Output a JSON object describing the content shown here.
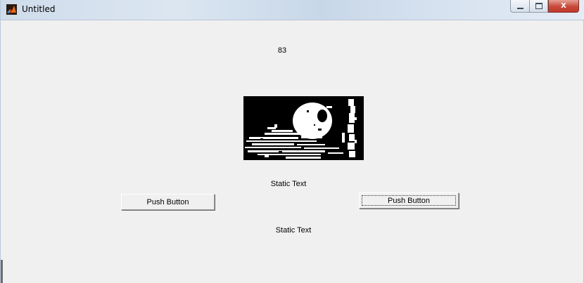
{
  "window": {
    "title": "Untitled",
    "caption_buttons": {
      "minimize_icon": "minimize-icon",
      "maximize_icon": "maximize-icon",
      "close_glyph": "X"
    }
  },
  "figure": {
    "value_display": "83",
    "image_description_icon": "binary-image",
    "static_text_top": "Static Text",
    "static_text_bottom": "Static Text",
    "push_button_left": "Push Button",
    "push_button_right": "Push Button"
  },
  "colors": {
    "window_background": "#f0f0f0",
    "close_button": "#c8493a",
    "axes_background": "#000000"
  }
}
